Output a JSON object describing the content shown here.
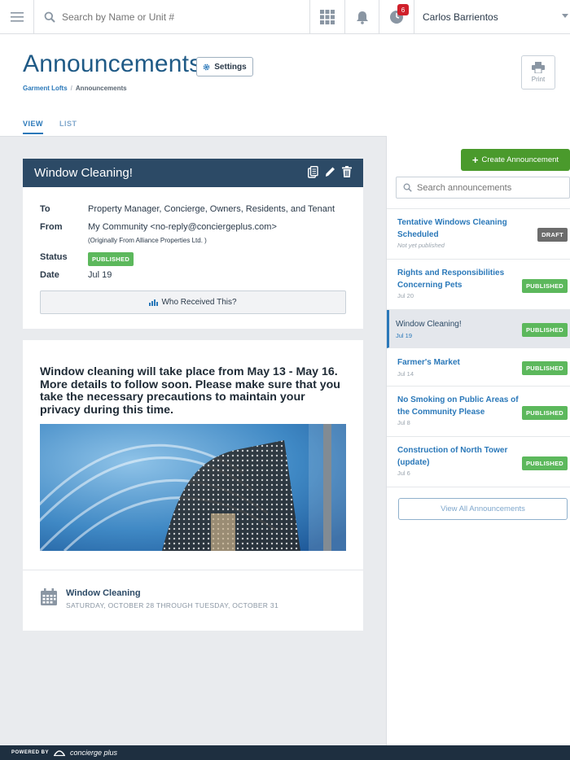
{
  "topbar": {
    "search_placeholder": "Search by Name or Unit #",
    "notification_count": "6",
    "user_name": "Carlos Barrientos"
  },
  "header": {
    "title": "Announcements",
    "settings_label": "Settings",
    "print_label": "Print",
    "breadcrumb": {
      "parent": "Garment Lofts",
      "separator": "/",
      "current": "Announcements"
    },
    "tabs": {
      "view": "VIEW",
      "list": "LIST"
    }
  },
  "announcement": {
    "title": "Window Cleaning!",
    "labels": {
      "to": "To",
      "from": "From",
      "status": "Status",
      "date": "Date"
    },
    "to": "Property Manager, Concierge, Owners, Residents, and Tenant",
    "from": "My Community <no-reply@conciergeplus.com>",
    "from_origin": "(Originally From Alliance Properties Ltd. )",
    "status": "PUBLISHED",
    "date": "Jul 19",
    "received_button": "Who Received This?",
    "body": "Window cleaning will take place from May 13 - May 16. More details to follow soon. Please make sure that you take the necessary precautions to maintain your privacy during this time.",
    "event": {
      "title": "Window Cleaning",
      "dates": "SATURDAY, OCTOBER 28 THROUGH TUESDAY, OCTOBER 31"
    }
  },
  "sidebar": {
    "create_label": "Create Announcement",
    "search_placeholder": "Search announcements",
    "items": [
      {
        "title": "Tentative Windows Cleaning Scheduled",
        "date": "Not yet published",
        "status": "DRAFT"
      },
      {
        "title": "Rights and Responsibilities Concerning Pets",
        "date": "Jul 20",
        "status": "PUBLISHED"
      },
      {
        "title": "Window Cleaning!",
        "date": "Jul 19",
        "status": "PUBLISHED"
      },
      {
        "title": "Farmer's Market",
        "date": "Jul 14",
        "status": "PUBLISHED"
      },
      {
        "title": "No Smoking on Public Areas of the Community Please",
        "date": "Jul 8",
        "status": "PUBLISHED"
      },
      {
        "title": "Construction of North Tower (update)",
        "date": "Jul 6",
        "status": "PUBLISHED"
      }
    ],
    "view_all_label": "View All Announcements"
  },
  "footer": {
    "powered_by": "POWERED BY",
    "brand": "concierge plus"
  },
  "colors": {
    "accent": "#2a78b9",
    "header_dark": "#2c4a66",
    "published": "#5cb85c",
    "draft": "#6c6c6c",
    "create": "#4a9a2c"
  }
}
